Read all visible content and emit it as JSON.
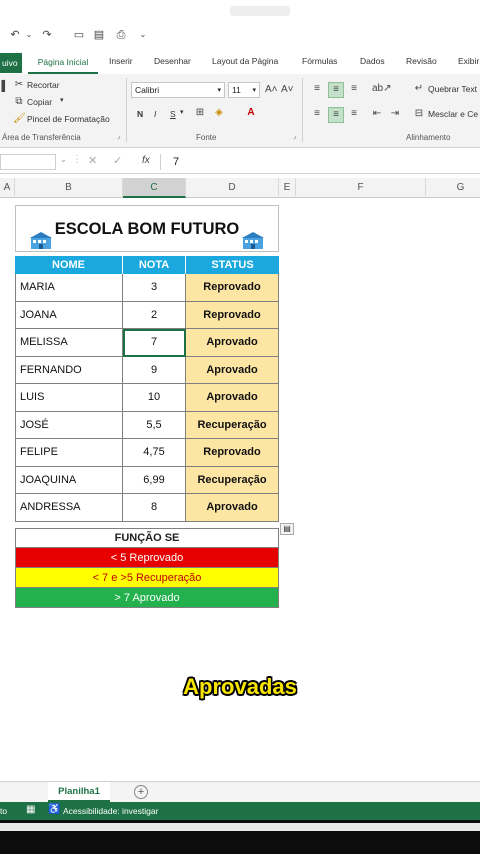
{
  "ribbon": {
    "tabs": [
      "uivo",
      "Página Inicial",
      "Inserir",
      "Desenhar",
      "Layout da Página",
      "Fórmulas",
      "Dados",
      "Revisão",
      "Exibir"
    ],
    "clipboard": {
      "cut": "Recortar",
      "copy": "Copiar",
      "format_painter": "Pincel de Formatação",
      "group": "Área de Transferência"
    },
    "font": {
      "name": "Calibri",
      "size": "11",
      "bold": "N",
      "italic": "I",
      "underline": "S",
      "group": "Fonte"
    },
    "alignment": {
      "wrap": "Quebrar Text",
      "merge": "Mesclar e Ce",
      "group": "Alinhamento"
    }
  },
  "formula_bar": {
    "fx": "fx",
    "value": "7"
  },
  "columns": [
    "A",
    "B",
    "C",
    "D",
    "E",
    "F",
    "G"
  ],
  "school": {
    "title": "ESCOLA BOM FUTURO",
    "headers": [
      "NOME",
      "NOTA",
      "STATUS"
    ],
    "rows": [
      {
        "name": "MARIA",
        "nota": "3",
        "status": "Reprovado"
      },
      {
        "name": "JOANA",
        "nota": "2",
        "status": "Reprovado"
      },
      {
        "name": "MELISSA",
        "nota": "7",
        "status": "Aprovado"
      },
      {
        "name": "FERNANDO",
        "nota": "9",
        "status": "Aprovado"
      },
      {
        "name": "LUIS",
        "nota": "10",
        "status": "Aprovado"
      },
      {
        "name": "JOSÉ",
        "nota": "5,5",
        "status": "Recuperação"
      },
      {
        "name": "FELIPE",
        "nota": "4,75",
        "status": "Reprovado"
      },
      {
        "name": "JOAQUINA",
        "nota": "6,99",
        "status": "Recuperação"
      },
      {
        "name": "ANDRESSA",
        "nota": "8",
        "status": "Aprovado"
      }
    ]
  },
  "legend": {
    "title": "FUNÇÃO SE",
    "items": [
      {
        "text": "< 5 Reprovado",
        "bg": "#e60000",
        "color": "#ffffff"
      },
      {
        "text": "< 7 e >5  Recuperação",
        "bg": "#ffff00",
        "color": "#c00000"
      },
      {
        "text": "> 7 Aprovado",
        "bg": "#22b14c",
        "color": "#ffffff"
      }
    ]
  },
  "caption": "Aprovadas",
  "sheet": {
    "tab": "Planilha1",
    "add": "+"
  },
  "status": {
    "left": "to",
    "accessibility": "Acessibilidade: investigar"
  },
  "colors": {
    "excel_green": "#1e7145",
    "header_blue": "#1aa8de",
    "status_fill": "#fde5a4"
  }
}
